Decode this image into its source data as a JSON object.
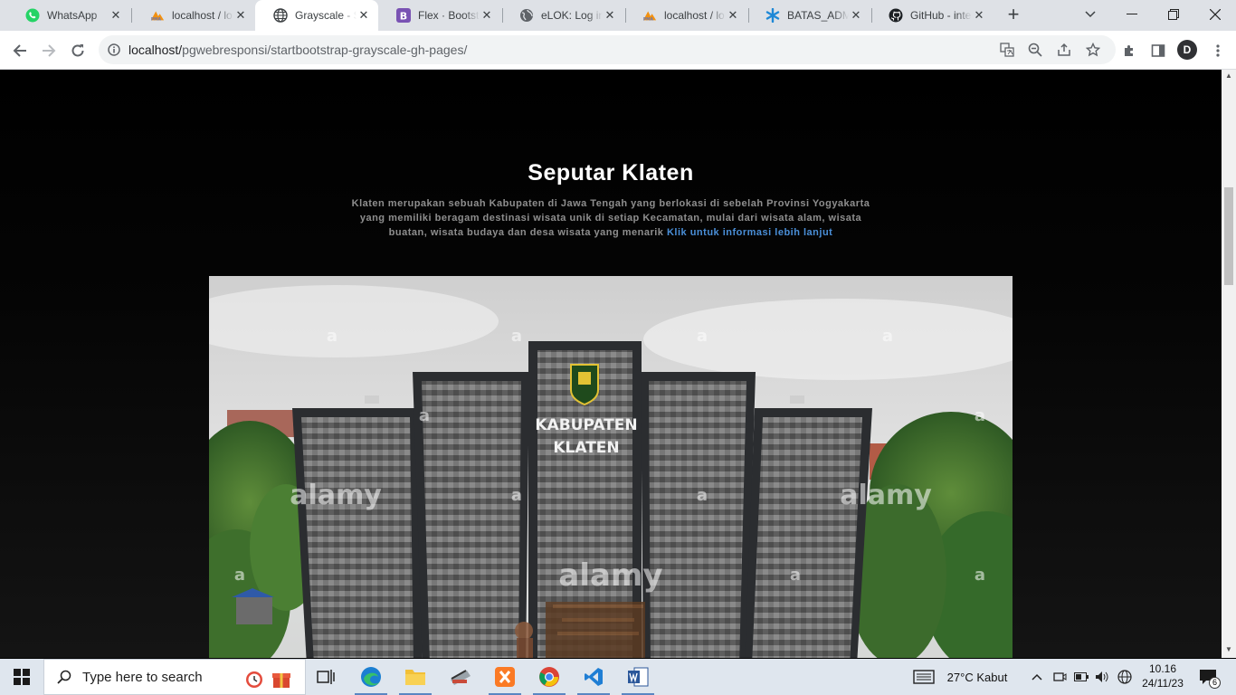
{
  "browser": {
    "tabs": [
      {
        "title": "WhatsApp",
        "favicon": "whatsapp-icon",
        "active": false
      },
      {
        "title": "localhost / lo",
        "favicon": "phpmyadmin-icon",
        "active": false
      },
      {
        "title": "Grayscale - S",
        "favicon": "globe-icon",
        "active": true
      },
      {
        "title": "Flex · Bootstr",
        "favicon": "bootstrap-icon",
        "active": false
      },
      {
        "title": "eLOK: Log in",
        "favicon": "world-icon",
        "active": false
      },
      {
        "title": "localhost / lo",
        "favicon": "phpmyadmin-icon",
        "active": false
      },
      {
        "title": "BATAS_ADMI",
        "favicon": "asterisk-icon",
        "active": false
      },
      {
        "title": "GitHub - inte",
        "favicon": "github-icon",
        "active": false
      }
    ],
    "new_tab_label": "+",
    "url_host": "localhost/",
    "url_path": "pgwebresponsi/startbootstrap-grayscale-gh-pages/",
    "profile_initial": "D"
  },
  "page": {
    "title": "Seputar Klaten",
    "description": "Klaten merupakan sebuah Kabupaten di Jawa Tengah yang berlokasi di sebelah Provinsi Yogyakarta yang memiliki beragam destinasi wisata unik di setiap Kecamatan, mulai dari wisata alam, wisata buatan, wisata budaya dan desa wisata yang menarik",
    "link_text": "Klik untuk informasi lebih lanjut",
    "photo": {
      "monument_line1": "KABUPATEN",
      "monument_line2": "KLATEN",
      "watermark": "alamy",
      "watermark_small": "a"
    }
  },
  "taskbar": {
    "search_placeholder": "Type here to search",
    "weather": "27°C  Kabut",
    "time": "10.16",
    "date": "24/11/23",
    "notification_count": "6"
  },
  "colors": {
    "link": "#4a8fd8",
    "page_bg": "#000000",
    "tab_strip": "#dee1e6"
  }
}
